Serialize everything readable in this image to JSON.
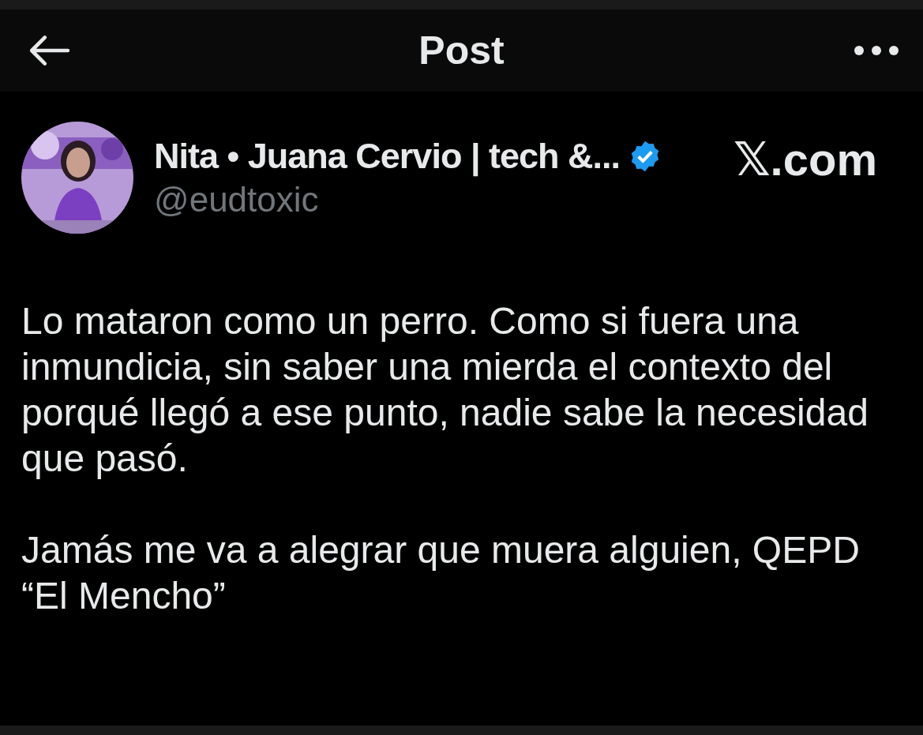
{
  "header": {
    "title": "Post"
  },
  "post": {
    "author": {
      "name": "Nita • Juana Cervio | tech &...",
      "verified": true,
      "handle": "@eudtoxic"
    },
    "source_label": "𝕏.com",
    "paragraphs": [
      "Lo mataron como un perro. Como si fuera una inmundicia, sin saber una mierda el contexto del porqué llegó a ese punto, nadie sabe la necesidad que pasó.",
      "Jamás me va a alegrar que muera alguien, QEPD “El Mencho”"
    ]
  }
}
